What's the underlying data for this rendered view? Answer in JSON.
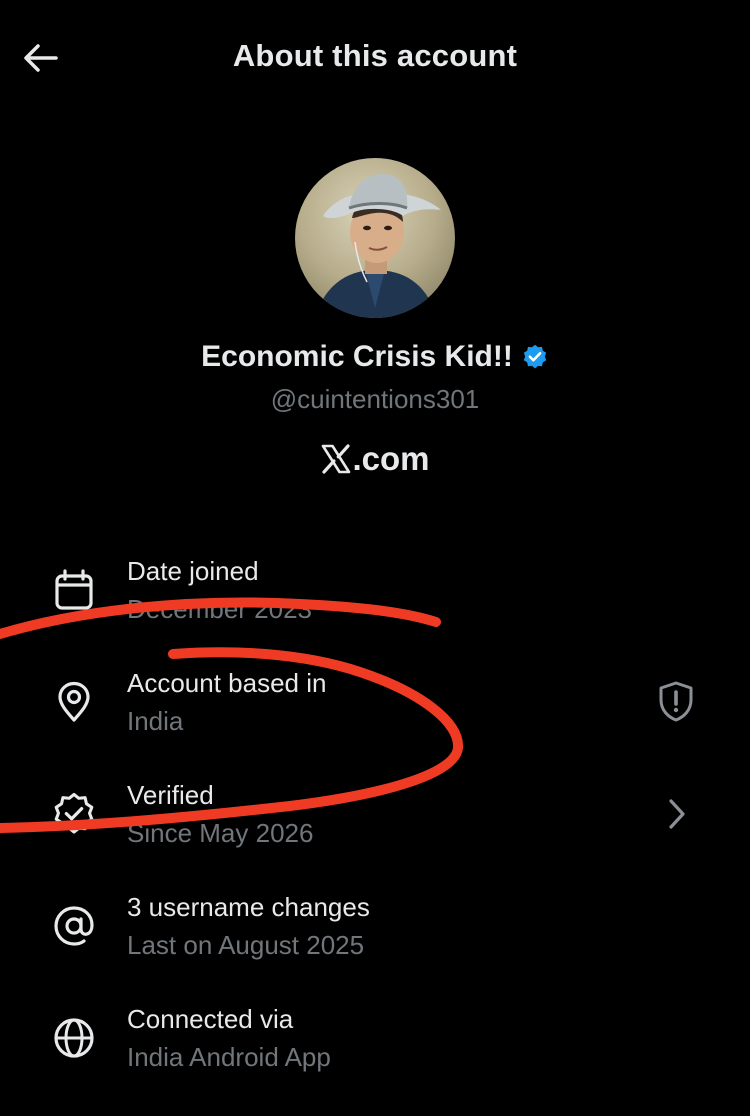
{
  "header": {
    "title": "About this account",
    "back_icon": "arrow-left-icon"
  },
  "profile": {
    "display_name": "Economic Crisis Kid!!",
    "handle": "@cuintentions301",
    "verified_badge_color": "#1d9bf0",
    "xcom_label": ".com"
  },
  "rows": [
    {
      "icon": "calendar-icon",
      "title": "Date joined",
      "subtitle": "December 2023"
    },
    {
      "icon": "location-pin-icon",
      "title": "Account based in",
      "subtitle": "India",
      "trailing_icon": "shield-alert-icon"
    },
    {
      "icon": "verified-badge-icon",
      "title": "Verified",
      "subtitle": "Since May 2026",
      "trailing_icon": "chevron-right-icon"
    },
    {
      "icon": "at-sign-icon",
      "title": "3 username changes",
      "subtitle": "Last on August 2025"
    },
    {
      "icon": "globe-icon",
      "title": "Connected via",
      "subtitle": "India Android App"
    }
  ],
  "colors": {
    "background": "#000000",
    "primary_text": "#e7e9ea",
    "secondary_text": "#71767b",
    "annotation_red": "#ef3b24"
  }
}
